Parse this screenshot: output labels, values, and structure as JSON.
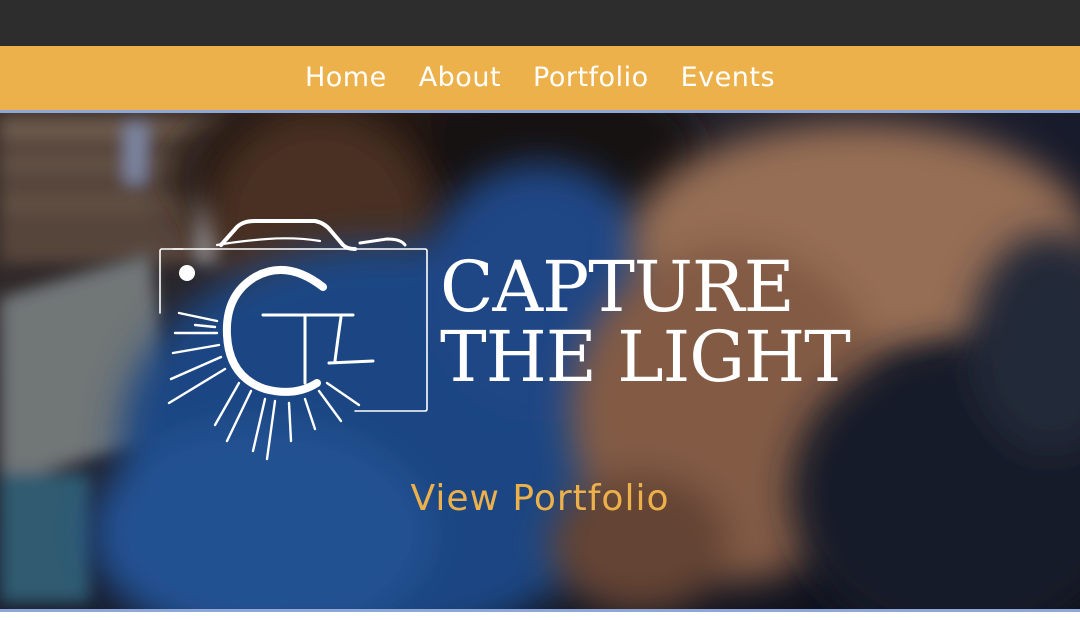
{
  "nav": {
    "items": [
      {
        "label": "Home"
      },
      {
        "label": "About"
      },
      {
        "label": "Portfolio"
      },
      {
        "label": "Events"
      }
    ]
  },
  "hero": {
    "logo_monogram": "CTL",
    "brand_line1": "CAPTURE",
    "brand_line2": "THE LIGHT",
    "cta_label": "View Portfolio"
  },
  "colors": {
    "topbar": "#2d2d2d",
    "nav_background": "#ecb14a",
    "accent": "#ecb14a",
    "divider": "#8ea7d6"
  },
  "icons": [
    "camera-logo-icon"
  ]
}
